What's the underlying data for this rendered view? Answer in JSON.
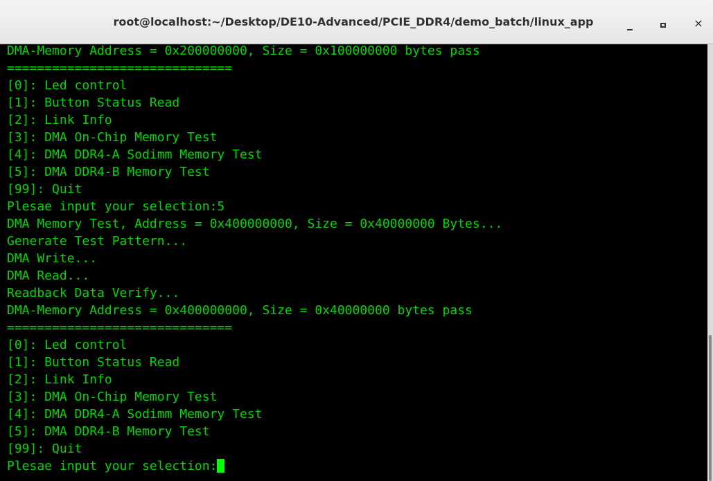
{
  "window": {
    "title": "root@localhost:~/Desktop/DE10-Advanced/PCIE_DDR4/demo_batch/linux_app"
  },
  "controls": {
    "minimize_icon": "minimize-icon",
    "maximize_icon": "maximize-icon",
    "close_icon": "close-icon",
    "close_glyph": "×"
  },
  "colors": {
    "terminal_bg": "#000000",
    "terminal_text": "#00d800",
    "cursor": "#00ff00"
  },
  "terminal": {
    "lines": [
      "DMA-Memory Address = 0x200000000, Size = 0x100000000 bytes pass",
      "==============================",
      "[0]: Led control",
      "[1]: Button Status Read",
      "[2]: Link Info",
      "[3]: DMA On-Chip Memory Test",
      "[4]: DMA DDR4-A Sodimm Memory Test",
      "[5]: DMA DDR4-B Memory Test",
      "[99]: Quit",
      "Plesae input your selection:5",
      "DMA Memory Test, Address = 0x400000000, Size = 0x40000000 Bytes...",
      "Generate Test Pattern...",
      "DMA Write...",
      "DMA Read...",
      "Readback Data Verify...",
      "DMA-Memory Address = 0x400000000, Size = 0x40000000 bytes pass",
      "==============================",
      "[0]: Led control",
      "[1]: Button Status Read",
      "[2]: Link Info",
      "[3]: DMA On-Chip Memory Test",
      "[4]: DMA DDR4-A Sodimm Memory Test",
      "[5]: DMA DDR4-B Memory Test",
      "[99]: Quit",
      "Plesae input your selection:"
    ]
  }
}
